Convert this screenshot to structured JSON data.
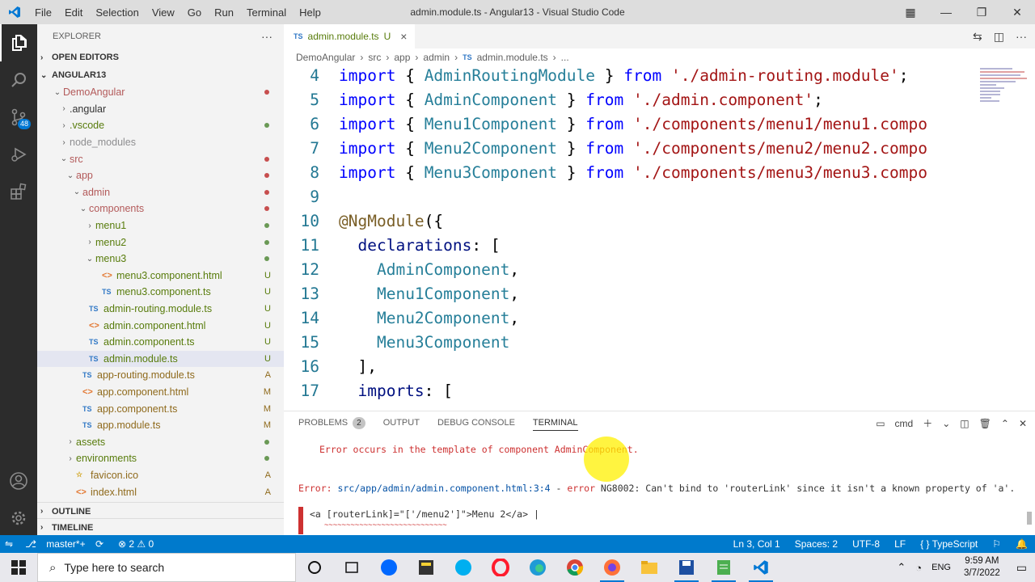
{
  "window": {
    "title": "admin.module.ts - Angular13 - Visual Studio Code",
    "menu": [
      "File",
      "Edit",
      "Selection",
      "View",
      "Go",
      "Run",
      "Terminal",
      "Help"
    ]
  },
  "activity_bar": {
    "scm_badge": "48"
  },
  "sidebar": {
    "header": "EXPLORER",
    "more": "···",
    "open_editors": "OPEN EDITORS",
    "root": "ANGULAR13",
    "tree": [
      {
        "label": "DemoAngular",
        "indent": 0,
        "chev": "⌄",
        "icon": "",
        "status": "",
        "dot": "#c74e4e",
        "color": "c-red"
      },
      {
        "label": ".angular",
        "indent": 1,
        "chev": "›",
        "icon": "",
        "status": "",
        "dot": "",
        "color": "c-tx"
      },
      {
        "label": ".vscode",
        "indent": 1,
        "chev": "›",
        "icon": "",
        "status": "",
        "dot": "#6a9955",
        "color": "c-grn"
      },
      {
        "label": "node_modules",
        "indent": 1,
        "chev": "›",
        "icon": "",
        "status": "",
        "dot": "",
        "color": "c-gry"
      },
      {
        "label": "src",
        "indent": 1,
        "chev": "⌄",
        "icon": "",
        "status": "",
        "dot": "#c74e4e",
        "color": "c-red"
      },
      {
        "label": "app",
        "indent": 2,
        "chev": "⌄",
        "icon": "",
        "status": "",
        "dot": "#c74e4e",
        "color": "c-red"
      },
      {
        "label": "admin",
        "indent": 3,
        "chev": "⌄",
        "icon": "",
        "status": "",
        "dot": "#c74e4e",
        "color": "c-red"
      },
      {
        "label": "components",
        "indent": 4,
        "chev": "⌄",
        "icon": "",
        "status": "",
        "dot": "#c74e4e",
        "color": "c-red"
      },
      {
        "label": "menu1",
        "indent": 5,
        "chev": "›",
        "icon": "",
        "status": "",
        "dot": "#6a9955",
        "color": "c-grn"
      },
      {
        "label": "menu2",
        "indent": 5,
        "chev": "›",
        "icon": "",
        "status": "",
        "dot": "#6a9955",
        "color": "c-grn"
      },
      {
        "label": "menu3",
        "indent": 5,
        "chev": "⌄",
        "icon": "",
        "status": "",
        "dot": "#6a9955",
        "color": "c-grn"
      },
      {
        "label": "menu3.component.html",
        "indent": 6,
        "chev": "",
        "icon": "<>",
        "status": "U",
        "dot": "",
        "color": "c-grn"
      },
      {
        "label": "menu3.component.ts",
        "indent": 6,
        "chev": "",
        "icon": "TS",
        "status": "U",
        "dot": "",
        "color": "c-grn"
      },
      {
        "label": "admin-routing.module.ts",
        "indent": 4,
        "chev": "",
        "icon": "TS",
        "status": "U",
        "dot": "",
        "color": "c-grn"
      },
      {
        "label": "admin.component.html",
        "indent": 4,
        "chev": "",
        "icon": "<>",
        "status": "U",
        "dot": "",
        "color": "c-grn"
      },
      {
        "label": "admin.component.ts",
        "indent": 4,
        "chev": "",
        "icon": "TS",
        "status": "U",
        "dot": "",
        "color": "c-grn"
      },
      {
        "label": "admin.module.ts",
        "indent": 4,
        "chev": "",
        "icon": "TS",
        "status": "U",
        "dot": "",
        "color": "c-grn",
        "selected": true
      },
      {
        "label": "app-routing.module.ts",
        "indent": 3,
        "chev": "",
        "icon": "TS",
        "status": "A",
        "dot": "",
        "color": "c-ora"
      },
      {
        "label": "app.component.html",
        "indent": 3,
        "chev": "",
        "icon": "<>",
        "status": "M",
        "dot": "",
        "color": "c-ora"
      },
      {
        "label": "app.component.ts",
        "indent": 3,
        "chev": "",
        "icon": "TS",
        "status": "M",
        "dot": "",
        "color": "c-ora"
      },
      {
        "label": "app.module.ts",
        "indent": 3,
        "chev": "",
        "icon": "TS",
        "status": "M",
        "dot": "",
        "color": "c-ora"
      },
      {
        "label": "assets",
        "indent": 2,
        "chev": "›",
        "icon": "",
        "status": "",
        "dot": "#6a9955",
        "color": "c-grn"
      },
      {
        "label": "environments",
        "indent": 2,
        "chev": "›",
        "icon": "",
        "status": "",
        "dot": "#6a9955",
        "color": "c-grn"
      },
      {
        "label": "favicon.ico",
        "indent": 2,
        "chev": "",
        "icon": "☆",
        "status": "A",
        "dot": "",
        "color": "c-ora"
      },
      {
        "label": "index.html",
        "indent": 2,
        "chev": "",
        "icon": "<>",
        "status": "A",
        "dot": "",
        "color": "c-ora"
      }
    ],
    "outline": "OUTLINE",
    "timeline": "TIMELINE"
  },
  "editor": {
    "tab": {
      "icon": "TS",
      "label": "admin.module.ts",
      "status": "U"
    },
    "breadcrumb": [
      "DemoAngular",
      "src",
      "app",
      "admin",
      "admin.module.ts",
      "..."
    ],
    "lines": [
      {
        "n": "4",
        "tokens": [
          [
            "kw",
            "import"
          ],
          [
            "pl",
            " { "
          ],
          [
            "ty",
            "AdminRoutingModule"
          ],
          [
            "pl",
            " } "
          ],
          [
            "kw",
            "from"
          ],
          [
            "pl",
            " "
          ],
          [
            "str",
            "'./admin-routing.module'"
          ],
          [
            "pl",
            ";"
          ]
        ]
      },
      {
        "n": "5",
        "tokens": [
          [
            "kw",
            "import"
          ],
          [
            "pl",
            " { "
          ],
          [
            "ty",
            "AdminComponent"
          ],
          [
            "pl",
            " } "
          ],
          [
            "kw",
            "from"
          ],
          [
            "pl",
            " "
          ],
          [
            "str",
            "'./admin.component'"
          ],
          [
            "pl",
            ";"
          ]
        ]
      },
      {
        "n": "6",
        "tokens": [
          [
            "kw",
            "import"
          ],
          [
            "pl",
            " { "
          ],
          [
            "ty",
            "Menu1Component"
          ],
          [
            "pl",
            " } "
          ],
          [
            "kw",
            "from"
          ],
          [
            "pl",
            " "
          ],
          [
            "str",
            "'./components/menu1/menu1.compo"
          ]
        ]
      },
      {
        "n": "7",
        "tokens": [
          [
            "kw",
            "import"
          ],
          [
            "pl",
            " { "
          ],
          [
            "ty",
            "Menu2Component"
          ],
          [
            "pl",
            " } "
          ],
          [
            "kw",
            "from"
          ],
          [
            "pl",
            " "
          ],
          [
            "str",
            "'./components/menu2/menu2.compo"
          ]
        ]
      },
      {
        "n": "8",
        "tokens": [
          [
            "kw",
            "import"
          ],
          [
            "pl",
            " { "
          ],
          [
            "ty",
            "Menu3Component"
          ],
          [
            "pl",
            " } "
          ],
          [
            "kw",
            "from"
          ],
          [
            "pl",
            " "
          ],
          [
            "str",
            "'./components/menu3/menu3.compo"
          ]
        ]
      },
      {
        "n": "9",
        "tokens": []
      },
      {
        "n": "10",
        "tokens": [
          [
            "fn",
            "@NgModule"
          ],
          [
            "pl",
            "({"
          ]
        ]
      },
      {
        "n": "11",
        "tokens": [
          [
            "pl",
            "  "
          ],
          [
            "prop",
            "declarations"
          ],
          [
            "pl",
            ": ["
          ]
        ]
      },
      {
        "n": "12",
        "tokens": [
          [
            "pl",
            "    "
          ],
          [
            "ty",
            "AdminComponent"
          ],
          [
            "pl",
            ","
          ]
        ]
      },
      {
        "n": "13",
        "tokens": [
          [
            "pl",
            "    "
          ],
          [
            "ty",
            "Menu1Component"
          ],
          [
            "pl",
            ","
          ]
        ]
      },
      {
        "n": "14",
        "tokens": [
          [
            "pl",
            "    "
          ],
          [
            "ty",
            "Menu2Component"
          ],
          [
            "pl",
            ","
          ]
        ]
      },
      {
        "n": "15",
        "tokens": [
          [
            "pl",
            "    "
          ],
          [
            "ty",
            "Menu3Component"
          ]
        ]
      },
      {
        "n": "16",
        "tokens": [
          [
            "pl",
            "  ],"
          ]
        ]
      },
      {
        "n": "17",
        "tokens": [
          [
            "pl",
            "  "
          ],
          [
            "prop",
            "imports"
          ],
          [
            "pl",
            ": ["
          ]
        ]
      }
    ]
  },
  "panel": {
    "tabs": [
      "PROBLEMS",
      "OUTPUT",
      "DEBUG CONSOLE",
      "TERMINAL"
    ],
    "problems_count": "2",
    "shell": "cmd",
    "error_header": "Error occurs in the template of component AdminComponent.",
    "error_prefix": "Error:",
    "error_path": "src/app/admin/admin.component.html",
    "error_loc": ":3:4",
    "error_dash": " - ",
    "error_word": "error",
    "error_msg": " NG8002: Can't bind to 'routerLink' since it isn't a known property of 'a'.",
    "code_snippet": "<a [routerLink]=\"['/menu2']\">Menu 2</a> |",
    "squiggle": "~~~~~~~~~~~~~~~~~~~~~~~~~~~~"
  },
  "status": {
    "branch": "master*+",
    "sync": "⟳",
    "errors": "2",
    "warnings": "0",
    "position": "Ln 3, Col 1",
    "spaces": "Spaces: 2",
    "encoding": "UTF-8",
    "eol": "LF",
    "language": "TypeScript"
  },
  "taskbar": {
    "search_placeholder": "Type here to search",
    "lang": "ENG",
    "time": "9:59 AM",
    "date": "3/7/2022"
  }
}
